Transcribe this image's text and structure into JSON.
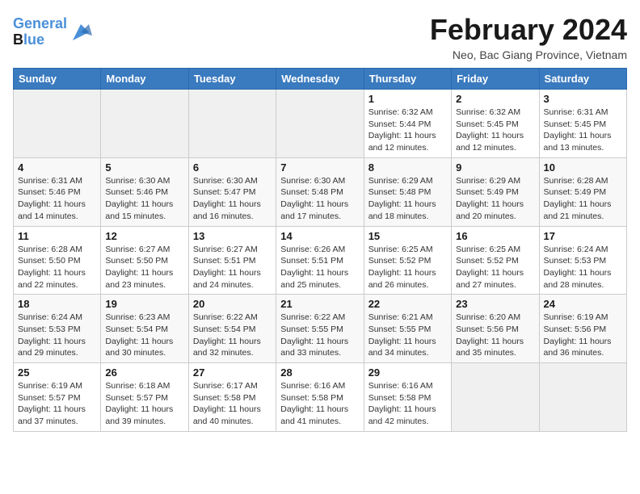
{
  "header": {
    "logo_line1": "General",
    "logo_line2": "Blue",
    "title": "February 2024",
    "subtitle": "Neo, Bac Giang Province, Vietnam"
  },
  "days_of_week": [
    "Sunday",
    "Monday",
    "Tuesday",
    "Wednesday",
    "Thursday",
    "Friday",
    "Saturday"
  ],
  "weeks": [
    [
      {
        "day": "",
        "info": ""
      },
      {
        "day": "",
        "info": ""
      },
      {
        "day": "",
        "info": ""
      },
      {
        "day": "",
        "info": ""
      },
      {
        "day": "1",
        "info": "Sunrise: 6:32 AM\nSunset: 5:44 PM\nDaylight: 11 hours and 12 minutes."
      },
      {
        "day": "2",
        "info": "Sunrise: 6:32 AM\nSunset: 5:45 PM\nDaylight: 11 hours and 12 minutes."
      },
      {
        "day": "3",
        "info": "Sunrise: 6:31 AM\nSunset: 5:45 PM\nDaylight: 11 hours and 13 minutes."
      }
    ],
    [
      {
        "day": "4",
        "info": "Sunrise: 6:31 AM\nSunset: 5:46 PM\nDaylight: 11 hours and 14 minutes."
      },
      {
        "day": "5",
        "info": "Sunrise: 6:30 AM\nSunset: 5:46 PM\nDaylight: 11 hours and 15 minutes."
      },
      {
        "day": "6",
        "info": "Sunrise: 6:30 AM\nSunset: 5:47 PM\nDaylight: 11 hours and 16 minutes."
      },
      {
        "day": "7",
        "info": "Sunrise: 6:30 AM\nSunset: 5:48 PM\nDaylight: 11 hours and 17 minutes."
      },
      {
        "day": "8",
        "info": "Sunrise: 6:29 AM\nSunset: 5:48 PM\nDaylight: 11 hours and 18 minutes."
      },
      {
        "day": "9",
        "info": "Sunrise: 6:29 AM\nSunset: 5:49 PM\nDaylight: 11 hours and 20 minutes."
      },
      {
        "day": "10",
        "info": "Sunrise: 6:28 AM\nSunset: 5:49 PM\nDaylight: 11 hours and 21 minutes."
      }
    ],
    [
      {
        "day": "11",
        "info": "Sunrise: 6:28 AM\nSunset: 5:50 PM\nDaylight: 11 hours and 22 minutes."
      },
      {
        "day": "12",
        "info": "Sunrise: 6:27 AM\nSunset: 5:50 PM\nDaylight: 11 hours and 23 minutes."
      },
      {
        "day": "13",
        "info": "Sunrise: 6:27 AM\nSunset: 5:51 PM\nDaylight: 11 hours and 24 minutes."
      },
      {
        "day": "14",
        "info": "Sunrise: 6:26 AM\nSunset: 5:51 PM\nDaylight: 11 hours and 25 minutes."
      },
      {
        "day": "15",
        "info": "Sunrise: 6:25 AM\nSunset: 5:52 PM\nDaylight: 11 hours and 26 minutes."
      },
      {
        "day": "16",
        "info": "Sunrise: 6:25 AM\nSunset: 5:52 PM\nDaylight: 11 hours and 27 minutes."
      },
      {
        "day": "17",
        "info": "Sunrise: 6:24 AM\nSunset: 5:53 PM\nDaylight: 11 hours and 28 minutes."
      }
    ],
    [
      {
        "day": "18",
        "info": "Sunrise: 6:24 AM\nSunset: 5:53 PM\nDaylight: 11 hours and 29 minutes."
      },
      {
        "day": "19",
        "info": "Sunrise: 6:23 AM\nSunset: 5:54 PM\nDaylight: 11 hours and 30 minutes."
      },
      {
        "day": "20",
        "info": "Sunrise: 6:22 AM\nSunset: 5:54 PM\nDaylight: 11 hours and 32 minutes."
      },
      {
        "day": "21",
        "info": "Sunrise: 6:22 AM\nSunset: 5:55 PM\nDaylight: 11 hours and 33 minutes."
      },
      {
        "day": "22",
        "info": "Sunrise: 6:21 AM\nSunset: 5:55 PM\nDaylight: 11 hours and 34 minutes."
      },
      {
        "day": "23",
        "info": "Sunrise: 6:20 AM\nSunset: 5:56 PM\nDaylight: 11 hours and 35 minutes."
      },
      {
        "day": "24",
        "info": "Sunrise: 6:19 AM\nSunset: 5:56 PM\nDaylight: 11 hours and 36 minutes."
      }
    ],
    [
      {
        "day": "25",
        "info": "Sunrise: 6:19 AM\nSunset: 5:57 PM\nDaylight: 11 hours and 37 minutes."
      },
      {
        "day": "26",
        "info": "Sunrise: 6:18 AM\nSunset: 5:57 PM\nDaylight: 11 hours and 39 minutes."
      },
      {
        "day": "27",
        "info": "Sunrise: 6:17 AM\nSunset: 5:58 PM\nDaylight: 11 hours and 40 minutes."
      },
      {
        "day": "28",
        "info": "Sunrise: 6:16 AM\nSunset: 5:58 PM\nDaylight: 11 hours and 41 minutes."
      },
      {
        "day": "29",
        "info": "Sunrise: 6:16 AM\nSunset: 5:58 PM\nDaylight: 11 hours and 42 minutes."
      },
      {
        "day": "",
        "info": ""
      },
      {
        "day": "",
        "info": ""
      }
    ]
  ]
}
